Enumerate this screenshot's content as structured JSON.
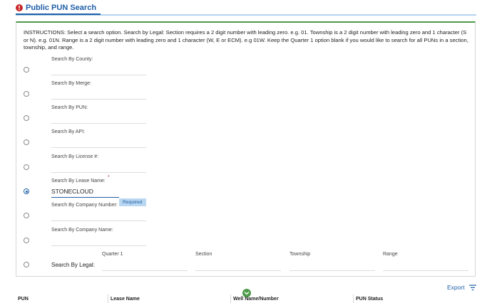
{
  "tab": {
    "icon": "alert-circle-icon",
    "title": "Public PUN Search"
  },
  "instructions": "INSTRUCTIONS: Select a search option. Search by Legal: Section requires a 2 digit number with leading zero. e.g. 01. Township is a 2 digit number with leading zero and 1 character (S or N). e.g. 01N. Range is a 2 digit number with leading zero and 1 character (W, E or ECM). e.g 01W. Keep the Quarter 1 option blank if you would like to search for all PUNs in a section, township, and range.",
  "fields": [
    {
      "label": "Search By County:",
      "value": ""
    },
    {
      "label": "Search By Merge:",
      "value": ""
    },
    {
      "label": "Search By PUN:",
      "value": ""
    },
    {
      "label": "Search By API:",
      "value": ""
    },
    {
      "label": "Search By License #:",
      "value": ""
    },
    {
      "label": "Search By Lease Name:",
      "value": "STONECLOUD",
      "required_mark": "*",
      "required_badge": "Required",
      "selected": true
    },
    {
      "label": "Search By Company Number:",
      "value": ""
    },
    {
      "label": "Search By Company Name:",
      "value": ""
    }
  ],
  "legal": {
    "label": "Search By Legal:",
    "columns": [
      "Quarter 1",
      "Section",
      "Township",
      "Range"
    ]
  },
  "export_label": "Export",
  "table_headers": [
    "PUN",
    "Lease Name",
    "Well Name/Number",
    "PUN Status"
  ],
  "colors": {
    "accent_blue": "#1f5fa8",
    "accent_green": "#4e9a4a",
    "alert_red": "#c62828"
  }
}
